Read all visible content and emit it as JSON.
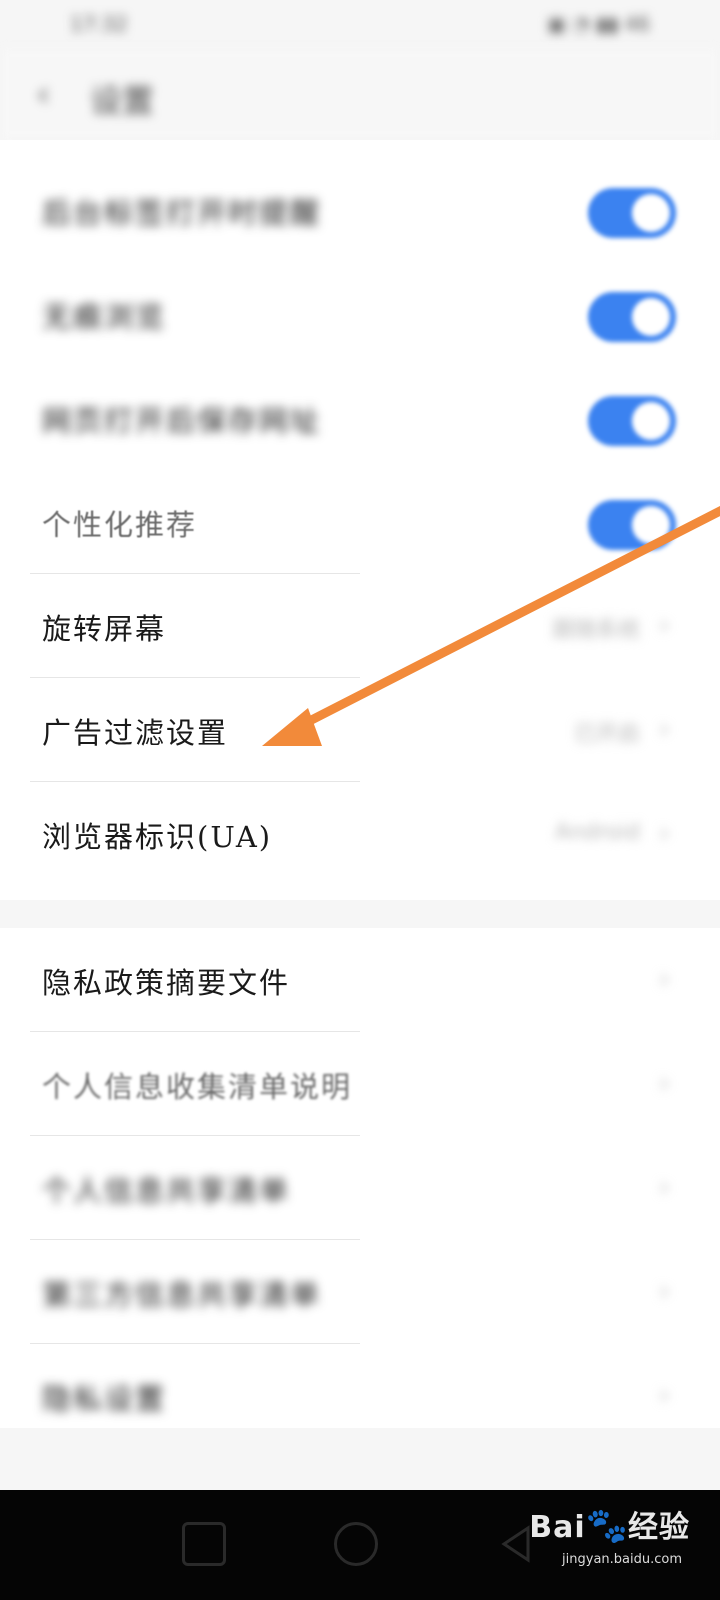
{
  "status_bar": {
    "time": "17:32",
    "icons": "▣ ◔ ▮▮ 46"
  },
  "header": {
    "back_glyph": "‹",
    "title": "设置"
  },
  "settings_section_1": [
    {
      "label": "后台标签打开时提醒",
      "type": "toggle",
      "on": true,
      "blurred": true
    },
    {
      "label": "无痕浏览",
      "type": "toggle",
      "on": true,
      "blurred": true
    },
    {
      "label": "网页打开后保存网址",
      "type": "toggle",
      "on": true,
      "blurred": true
    },
    {
      "label": "个性化推荐",
      "type": "toggle",
      "on": true,
      "blurred": false,
      "dim": true
    },
    {
      "label": "旋转屏幕",
      "type": "link",
      "value": "跟随系统",
      "blurred": false
    },
    {
      "label": "广告过滤设置",
      "type": "link",
      "value": "已开启",
      "blurred": false
    },
    {
      "label": "浏览器标识(UA)",
      "type": "link",
      "value": "Android",
      "blurred": false
    }
  ],
  "settings_section_2": [
    {
      "label": "隐私政策摘要文件",
      "blurred": false
    },
    {
      "label": "个人信息收集清单说明",
      "blurred": false,
      "dim": true
    },
    {
      "label": "个人信息共享清单",
      "blurred": true
    },
    {
      "label": "第三方信息共享清单",
      "blurred": true
    },
    {
      "label": "隐私设置",
      "blurred": true
    }
  ],
  "chevron_glyph": "›",
  "annotation": {
    "color": "#f28a3a",
    "icon": "arrow-pointer"
  },
  "toggle_color": "#3b82f0",
  "watermark": {
    "brand": "Bai",
    "brand_tail": "经验",
    "paw": "🐾",
    "url": "jingyan.baidu.com"
  }
}
